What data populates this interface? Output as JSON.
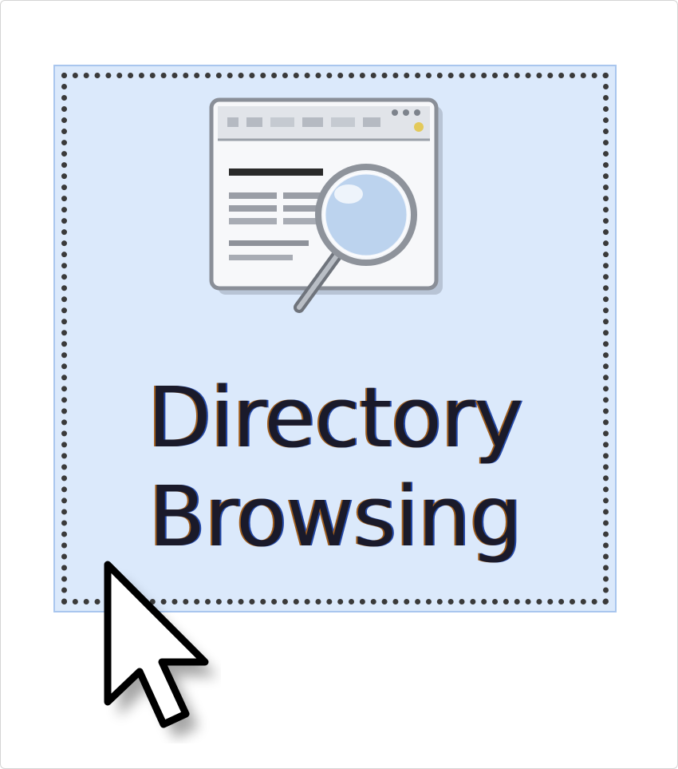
{
  "feature_tile": {
    "label_line1": "Directory",
    "label_line2": "Browsing",
    "icon": "directory-browsing-icon",
    "selected": true,
    "colors": {
      "selection_fill": "#dbe9fb",
      "selection_border": "#a9c6ee",
      "focus_dots": "#3a3a3a"
    }
  },
  "cursor": {
    "icon": "mouse-pointer-icon"
  }
}
